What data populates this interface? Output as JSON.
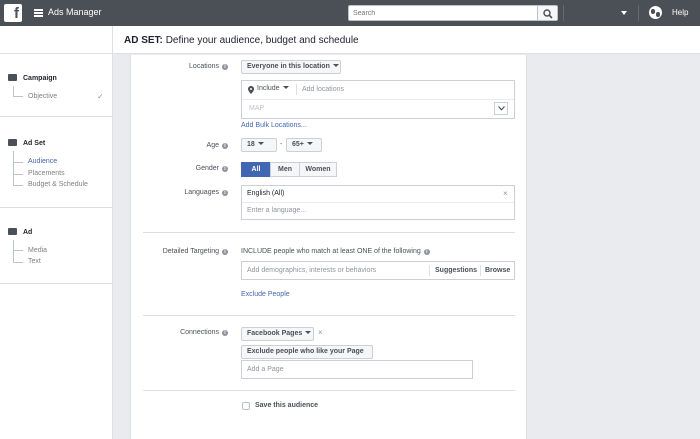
{
  "topbar": {
    "logo": "f",
    "app_title": "Ads Manager",
    "search_placeholder": "Search",
    "help_label": "Help"
  },
  "header": {
    "prefix": "AD SET:",
    "title": "Define your audience, budget and schedule"
  },
  "sidebar": {
    "campaign": {
      "label": "Campaign",
      "items": [
        "Objective"
      ]
    },
    "adset": {
      "label": "Ad Set",
      "items": [
        "Audience",
        "Placements",
        "Budget & Schedule"
      ]
    },
    "ad": {
      "label": "Ad",
      "items": [
        "Media",
        "Text"
      ]
    }
  },
  "form": {
    "locations": {
      "label": "Locations",
      "scope_value": "Everyone in this location",
      "include_value": "Include",
      "add_placeholder": "Add locations",
      "map_label": "MAP",
      "bulk_link": "Add Bulk Locations..."
    },
    "age": {
      "label": "Age",
      "min": "18",
      "separator": "-",
      "max": "65+"
    },
    "gender": {
      "label": "Gender",
      "options": [
        "All",
        "Men",
        "Women"
      ],
      "selected": "All"
    },
    "languages": {
      "label": "Languages",
      "selected_value": "English (All)",
      "placeholder": "Enter a language..."
    },
    "detailed_targeting": {
      "label": "Detailed Targeting",
      "description": "INCLUDE people who match at least ONE of the following",
      "placeholder": "Add demographics, interests or behaviors",
      "suggestions": "Suggestions",
      "browse": "Browse",
      "exclude_link": "Exclude People"
    },
    "connections": {
      "label": "Connections",
      "type_value": "Facebook Pages",
      "rule_value": "Exclude people who like your Page",
      "page_placeholder": "Add a Page"
    },
    "save_audience": {
      "label": "Save this audience"
    }
  },
  "colors": {
    "topbar": "#4b4f56",
    "accent": "#4267b2",
    "background": "#e9ebee"
  }
}
